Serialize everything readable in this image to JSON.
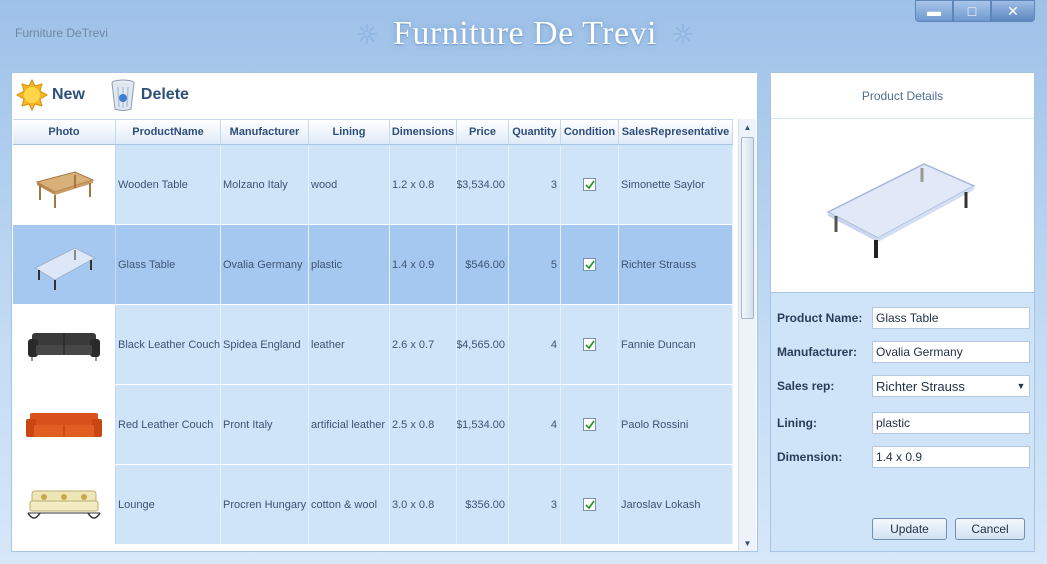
{
  "app": {
    "name": "Furniture DeTrevi",
    "banner_title": "Furniture De Trevi"
  },
  "window_controls": {
    "minimize": "▬",
    "maximize": "□",
    "close": "✕"
  },
  "toolbar": {
    "new_label": "New",
    "delete_label": "Delete"
  },
  "grid": {
    "columns": [
      "Photo",
      "ProductName",
      "Manufacturer",
      "Lining",
      "Dimensions",
      "Price",
      "Quantity",
      "Condition",
      "SalesRepresentative"
    ],
    "rows": [
      {
        "product": "Wooden Table",
        "manufacturer": "Molzano Italy",
        "lining": "wood",
        "dimensions": "1.2 x 0.8",
        "price": "$3,534.00",
        "quantity": "3",
        "condition": true,
        "rep": "Simonette Saylor",
        "photo_icon": "wooden-table-image"
      },
      {
        "product": "Glass Table",
        "manufacturer": "Ovalia Germany",
        "lining": "plastic",
        "dimensions": "1.4 x 0.9",
        "price": "$546.00",
        "quantity": "5",
        "condition": true,
        "rep": "Richter Strauss",
        "photo_icon": "glass-table-image",
        "selected": true
      },
      {
        "product": "Black Leather Couch",
        "manufacturer": "Spidea England",
        "lining": "leather",
        "dimensions": "2.6 x 0.7",
        "price": "$4,565.00",
        "quantity": "4",
        "condition": true,
        "rep": "Fannie Duncan",
        "photo_icon": "black-couch-image"
      },
      {
        "product": "Red Leather Couch",
        "manufacturer": "Pront Italy",
        "lining": "artificial leather",
        "dimensions": "2.5 x 0.8",
        "price": "$1,534.00",
        "quantity": "4",
        "condition": true,
        "rep": "Paolo Rossini",
        "photo_icon": "red-couch-image"
      },
      {
        "product": "Lounge",
        "manufacturer": "Procren Hungary",
        "lining": "cotton & wool",
        "dimensions": "3.0 x 0.8",
        "price": "$356.00",
        "quantity": "3",
        "condition": true,
        "rep": "Jaroslav Lokash",
        "photo_icon": "lounge-image"
      }
    ]
  },
  "details": {
    "title": "Product Details",
    "labels": {
      "name": "Product Name:",
      "manufacturer": "Manufacturer:",
      "rep": "Sales rep:",
      "lining": "Lining:",
      "dimension": "Dimension:"
    },
    "values": {
      "name": "Glass Table",
      "manufacturer": "Ovalia Germany",
      "rep": "Richter Strauss",
      "lining": "plastic",
      "dimension": "1.4 x 0.9"
    },
    "update_label": "Update",
    "cancel_label": "Cancel"
  },
  "colors": {
    "row_bg": "#cfe3f9",
    "selected_bg": "#a5c8f0",
    "header_text": "#2d4f7c",
    "accent": "#9ec1e8"
  }
}
